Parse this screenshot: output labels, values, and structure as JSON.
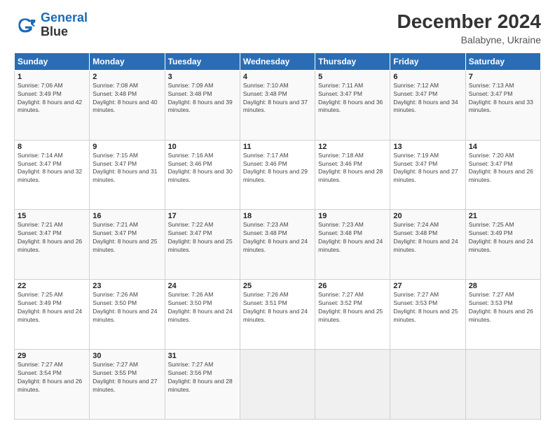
{
  "logo": {
    "line1": "General",
    "line2": "Blue"
  },
  "title": "December 2024",
  "subtitle": "Balabyne, Ukraine",
  "days_of_week": [
    "Sunday",
    "Monday",
    "Tuesday",
    "Wednesday",
    "Thursday",
    "Friday",
    "Saturday"
  ],
  "weeks": [
    [
      {
        "day": 1,
        "sunrise": "7:06 AM",
        "sunset": "3:49 PM",
        "daylight": "8 hours and 42 minutes."
      },
      {
        "day": 2,
        "sunrise": "7:08 AM",
        "sunset": "3:48 PM",
        "daylight": "8 hours and 40 minutes."
      },
      {
        "day": 3,
        "sunrise": "7:09 AM",
        "sunset": "3:48 PM",
        "daylight": "8 hours and 39 minutes."
      },
      {
        "day": 4,
        "sunrise": "7:10 AM",
        "sunset": "3:48 PM",
        "daylight": "8 hours and 37 minutes."
      },
      {
        "day": 5,
        "sunrise": "7:11 AM",
        "sunset": "3:47 PM",
        "daylight": "8 hours and 36 minutes."
      },
      {
        "day": 6,
        "sunrise": "7:12 AM",
        "sunset": "3:47 PM",
        "daylight": "8 hours and 34 minutes."
      },
      {
        "day": 7,
        "sunrise": "7:13 AM",
        "sunset": "3:47 PM",
        "daylight": "8 hours and 33 minutes."
      }
    ],
    [
      {
        "day": 8,
        "sunrise": "7:14 AM",
        "sunset": "3:47 PM",
        "daylight": "8 hours and 32 minutes."
      },
      {
        "day": 9,
        "sunrise": "7:15 AM",
        "sunset": "3:47 PM",
        "daylight": "8 hours and 31 minutes."
      },
      {
        "day": 10,
        "sunrise": "7:16 AM",
        "sunset": "3:46 PM",
        "daylight": "8 hours and 30 minutes."
      },
      {
        "day": 11,
        "sunrise": "7:17 AM",
        "sunset": "3:46 PM",
        "daylight": "8 hours and 29 minutes."
      },
      {
        "day": 12,
        "sunrise": "7:18 AM",
        "sunset": "3:46 PM",
        "daylight": "8 hours and 28 minutes."
      },
      {
        "day": 13,
        "sunrise": "7:19 AM",
        "sunset": "3:47 PM",
        "daylight": "8 hours and 27 minutes."
      },
      {
        "day": 14,
        "sunrise": "7:20 AM",
        "sunset": "3:47 PM",
        "daylight": "8 hours and 26 minutes."
      }
    ],
    [
      {
        "day": 15,
        "sunrise": "7:21 AM",
        "sunset": "3:47 PM",
        "daylight": "8 hours and 26 minutes."
      },
      {
        "day": 16,
        "sunrise": "7:21 AM",
        "sunset": "3:47 PM",
        "daylight": "8 hours and 25 minutes."
      },
      {
        "day": 17,
        "sunrise": "7:22 AM",
        "sunset": "3:47 PM",
        "daylight": "8 hours and 25 minutes."
      },
      {
        "day": 18,
        "sunrise": "7:23 AM",
        "sunset": "3:48 PM",
        "daylight": "8 hours and 24 minutes."
      },
      {
        "day": 19,
        "sunrise": "7:23 AM",
        "sunset": "3:48 PM",
        "daylight": "8 hours and 24 minutes."
      },
      {
        "day": 20,
        "sunrise": "7:24 AM",
        "sunset": "3:48 PM",
        "daylight": "8 hours and 24 minutes."
      },
      {
        "day": 21,
        "sunrise": "7:25 AM",
        "sunset": "3:49 PM",
        "daylight": "8 hours and 24 minutes."
      }
    ],
    [
      {
        "day": 22,
        "sunrise": "7:25 AM",
        "sunset": "3:49 PM",
        "daylight": "8 hours and 24 minutes."
      },
      {
        "day": 23,
        "sunrise": "7:26 AM",
        "sunset": "3:50 PM",
        "daylight": "8 hours and 24 minutes."
      },
      {
        "day": 24,
        "sunrise": "7:26 AM",
        "sunset": "3:50 PM",
        "daylight": "8 hours and 24 minutes."
      },
      {
        "day": 25,
        "sunrise": "7:26 AM",
        "sunset": "3:51 PM",
        "daylight": "8 hours and 24 minutes."
      },
      {
        "day": 26,
        "sunrise": "7:27 AM",
        "sunset": "3:52 PM",
        "daylight": "8 hours and 25 minutes."
      },
      {
        "day": 27,
        "sunrise": "7:27 AM",
        "sunset": "3:53 PM",
        "daylight": "8 hours and 25 minutes."
      },
      {
        "day": 28,
        "sunrise": "7:27 AM",
        "sunset": "3:53 PM",
        "daylight": "8 hours and 26 minutes."
      }
    ],
    [
      {
        "day": 29,
        "sunrise": "7:27 AM",
        "sunset": "3:54 PM",
        "daylight": "8 hours and 26 minutes."
      },
      {
        "day": 30,
        "sunrise": "7:27 AM",
        "sunset": "3:55 PM",
        "daylight": "8 hours and 27 minutes."
      },
      {
        "day": 31,
        "sunrise": "7:27 AM",
        "sunset": "3:56 PM",
        "daylight": "8 hours and 28 minutes."
      },
      null,
      null,
      null,
      null
    ]
  ]
}
